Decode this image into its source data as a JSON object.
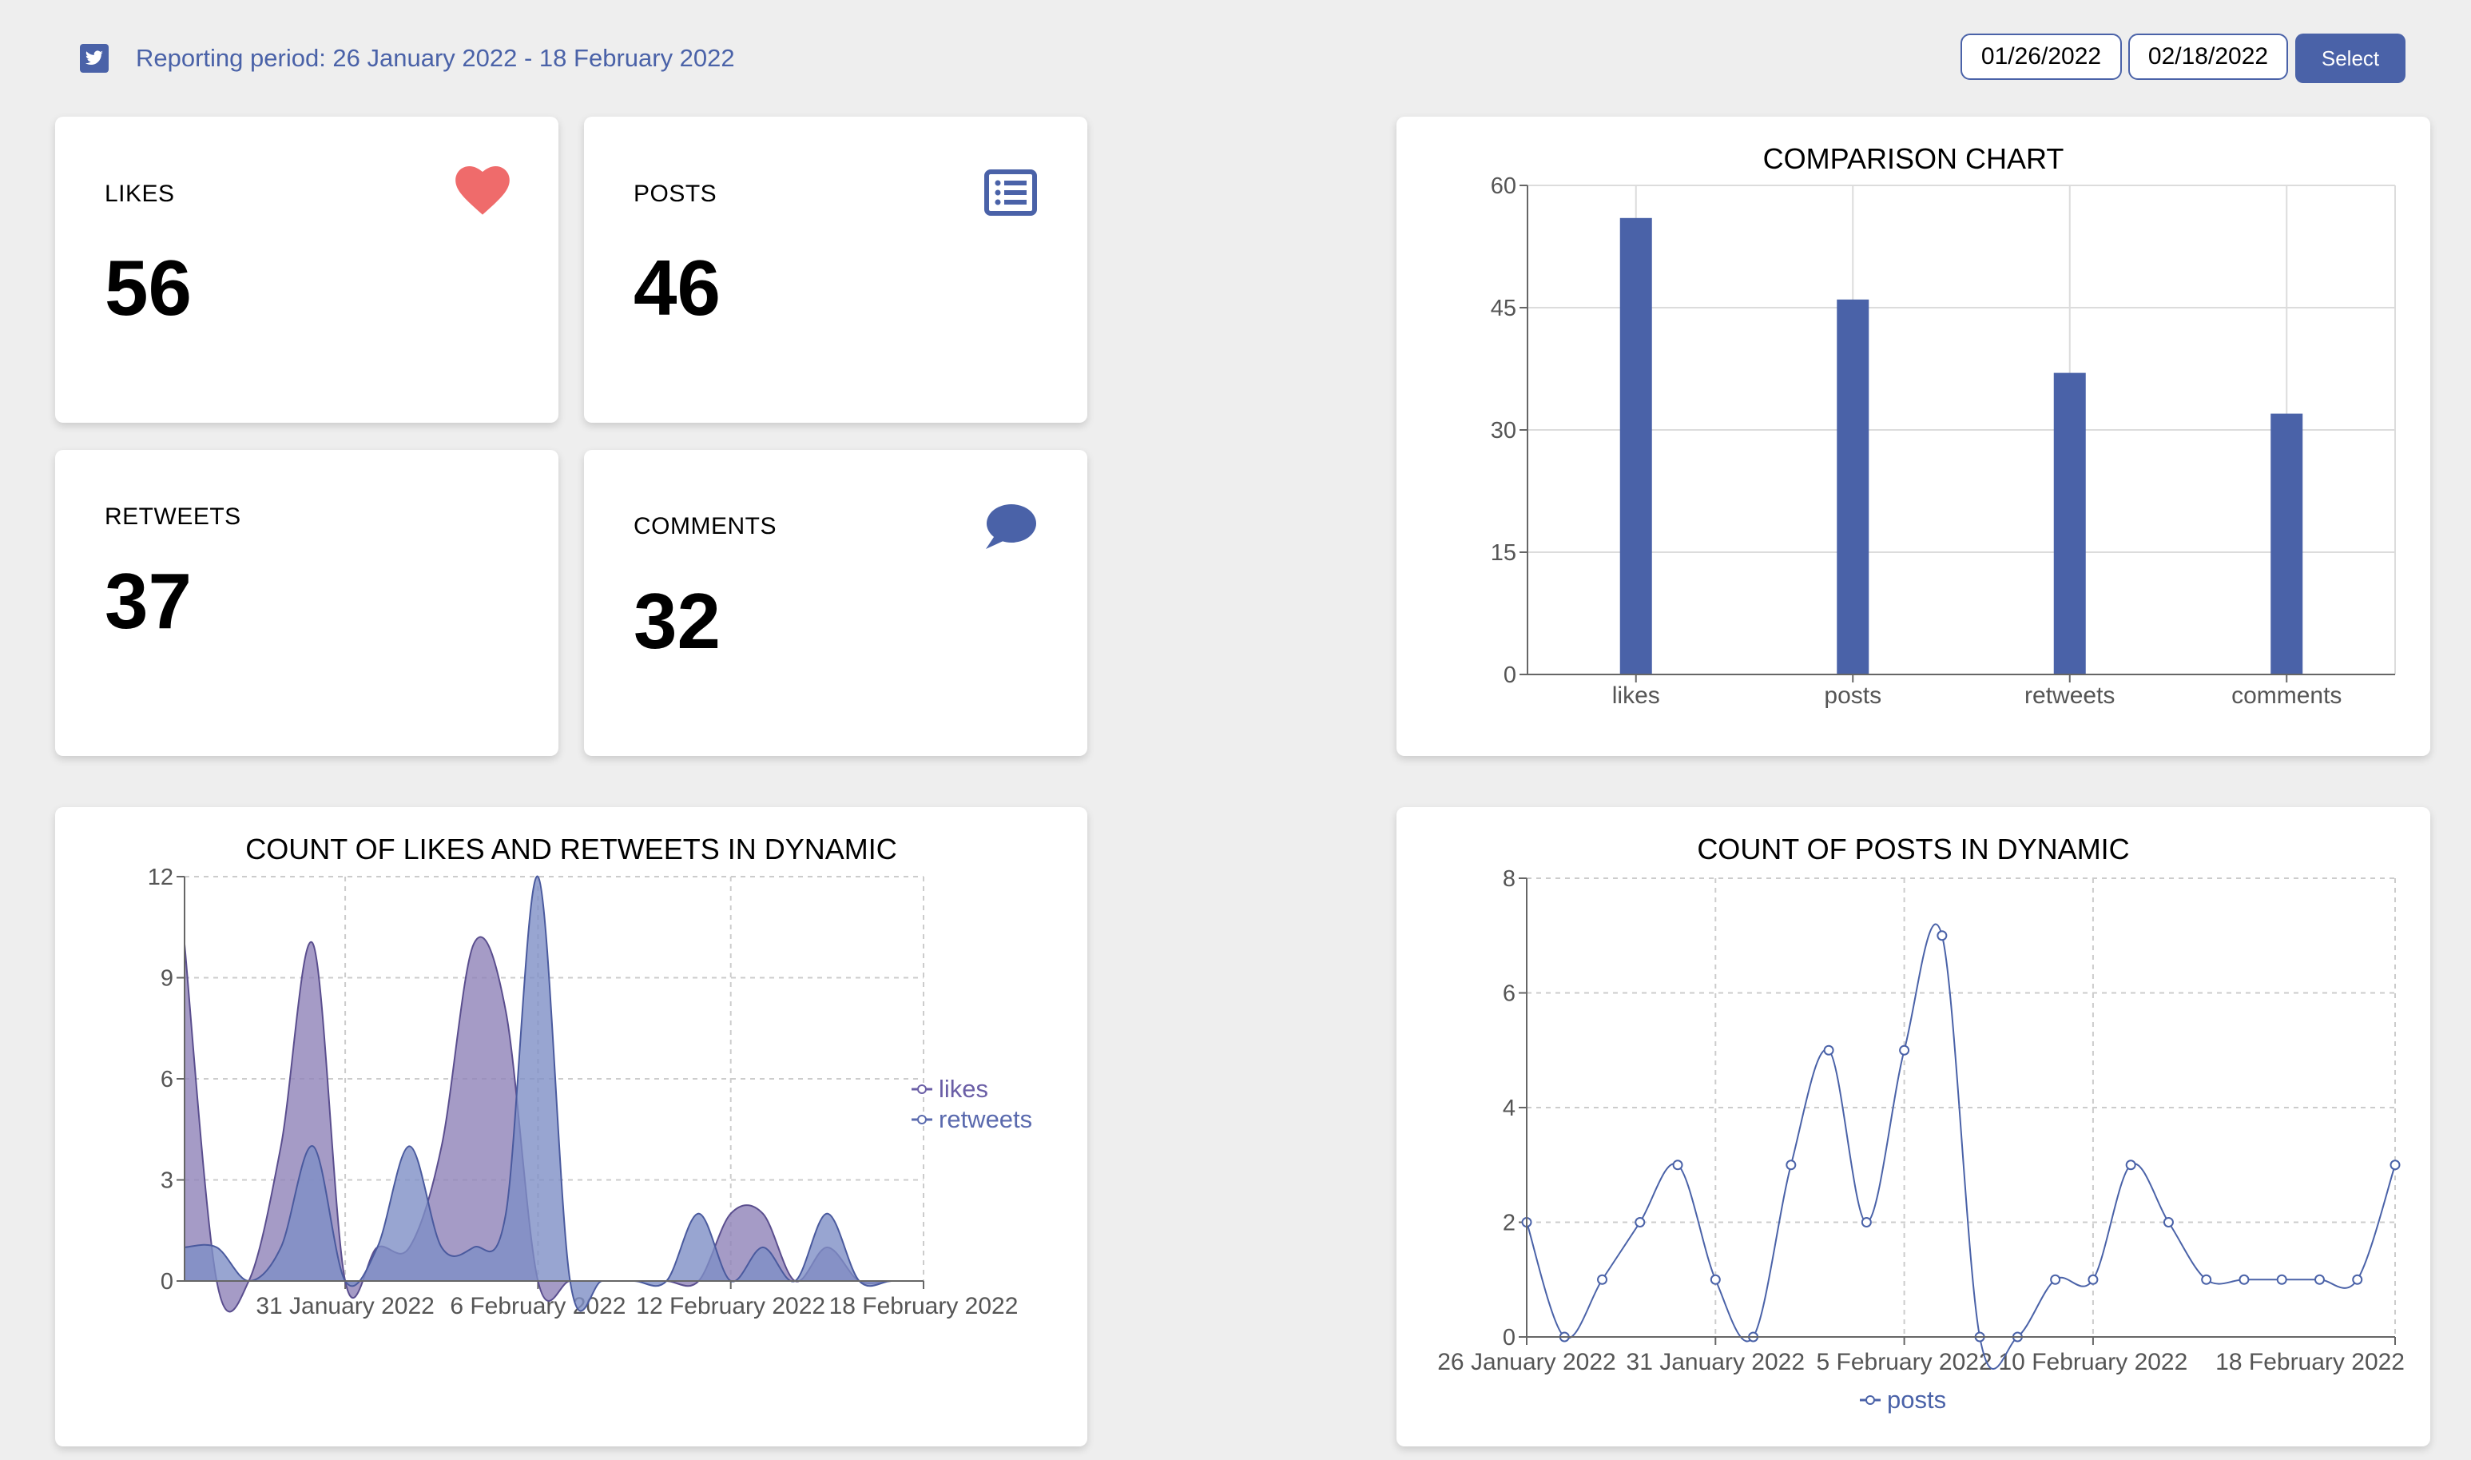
{
  "header": {
    "period_text": "Reporting period: 26 January 2022 - 18 February 2022",
    "date_from": "01/26/2022",
    "date_to": "02/18/2022",
    "select_label": "Select"
  },
  "icons": {
    "brand": "twitter-icon",
    "likes": "heart-icon",
    "posts": "list-icon",
    "comments": "speech-bubble-icon"
  },
  "colors": {
    "accent": "#4a62a8",
    "heart": "#ef6b6b",
    "likes_area": "#8f82b8",
    "retweets_area": "#7e8fc6"
  },
  "stats": [
    {
      "label": "LIKES",
      "value": "56"
    },
    {
      "label": "POSTS",
      "value": "46"
    },
    {
      "label": "RETWEETS",
      "value": "37"
    },
    {
      "label": "COMMENTS",
      "value": "32"
    }
  ],
  "chart_data": [
    {
      "type": "bar",
      "title": "COMPARISON CHART",
      "categories": [
        "likes",
        "posts",
        "retweets",
        "comments"
      ],
      "values": [
        56,
        46,
        37,
        32
      ],
      "ylim": [
        0,
        60
      ],
      "yticks": [
        "0",
        "15",
        "30",
        "45",
        "60"
      ],
      "grid": true
    },
    {
      "type": "area",
      "title": "COUNT OF LIKES AND RETWEETS IN DYNAMIC",
      "x": [
        "2022-01-26",
        "2022-01-27",
        "2022-01-28",
        "2022-01-29",
        "2022-01-30",
        "2022-01-31",
        "2022-02-01",
        "2022-02-02",
        "2022-02-03",
        "2022-02-04",
        "2022-02-05",
        "2022-02-06",
        "2022-02-07",
        "2022-02-08",
        "2022-02-09",
        "2022-02-10",
        "2022-02-11",
        "2022-02-12",
        "2022-02-13",
        "2022-02-14",
        "2022-02-15",
        "2022-02-16",
        "2022-02-17",
        "2022-02-18"
      ],
      "xtick_labels": [
        "31 January 2022",
        "6 February 2022",
        "12 February 2022",
        "18 February 2022"
      ],
      "yticks": [
        "0",
        "3",
        "6",
        "9",
        "12"
      ],
      "ylim": [
        0,
        12
      ],
      "series": [
        {
          "name": "likes",
          "values": [
            10,
            0,
            0,
            4,
            10,
            0,
            1,
            1,
            4,
            10,
            8,
            0,
            0,
            0,
            0,
            0,
            0,
            2,
            2,
            0,
            1,
            0,
            0,
            0
          ]
        },
        {
          "name": "retweets",
          "values": [
            1,
            1,
            0,
            1,
            4,
            0,
            1,
            4,
            1,
            1,
            2,
            12,
            0,
            0,
            0,
            0,
            2,
            0,
            1,
            0,
            2,
            0,
            0,
            0
          ]
        }
      ],
      "legend": "right",
      "grid": true
    },
    {
      "type": "line",
      "title": "COUNT OF POSTS IN DYNAMIC",
      "x": [
        "2022-01-26",
        "2022-01-27",
        "2022-01-28",
        "2022-01-29",
        "2022-01-30",
        "2022-01-31",
        "2022-02-01",
        "2022-02-02",
        "2022-02-03",
        "2022-02-04",
        "2022-02-05",
        "2022-02-06",
        "2022-02-07",
        "2022-02-08",
        "2022-02-09",
        "2022-02-10",
        "2022-02-11",
        "2022-02-12",
        "2022-02-13",
        "2022-02-14",
        "2022-02-15",
        "2022-02-16",
        "2022-02-17",
        "2022-02-18"
      ],
      "xtick_labels": [
        "26 January 2022",
        "31 January 2022",
        "5 February 2022",
        "10 February 2022",
        "18 February 2022"
      ],
      "yticks": [
        "0",
        "2",
        "4",
        "6",
        "8"
      ],
      "ylim": [
        0,
        8
      ],
      "series": [
        {
          "name": "posts",
          "values": [
            2,
            0,
            1,
            2,
            3,
            1,
            0,
            3,
            5,
            2,
            5,
            7,
            0,
            0,
            1,
            1,
            3,
            2,
            1,
            1,
            1,
            1,
            1,
            3
          ]
        }
      ],
      "legend": "bottom",
      "grid": true
    }
  ]
}
